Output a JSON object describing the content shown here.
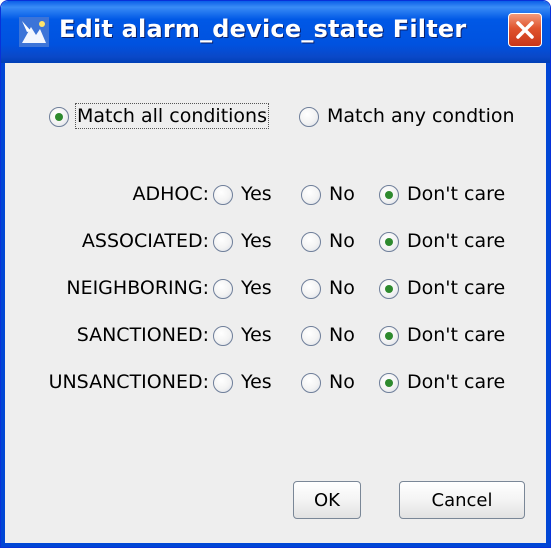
{
  "window": {
    "title": "Edit alarm_device_state Filter",
    "accent": "#0058e6",
    "close_icon": "close-x-icon"
  },
  "match": {
    "all_label": "Match all conditions",
    "any_label": "Match any condtion",
    "selected": "all"
  },
  "conditions": [
    {
      "label": "ADHOC:",
      "selected": "dontcare"
    },
    {
      "label": "ASSOCIATED:",
      "selected": "dontcare"
    },
    {
      "label": "NEIGHBORING:",
      "selected": "dontcare"
    },
    {
      "label": "SANCTIONED:",
      "selected": "dontcare"
    },
    {
      "label": "UNSANCTIONED:",
      "selected": "dontcare"
    }
  ],
  "options": {
    "yes": "Yes",
    "no": "No",
    "dontcare": "Don't care"
  },
  "buttons": {
    "ok": "OK",
    "cancel": "Cancel"
  }
}
